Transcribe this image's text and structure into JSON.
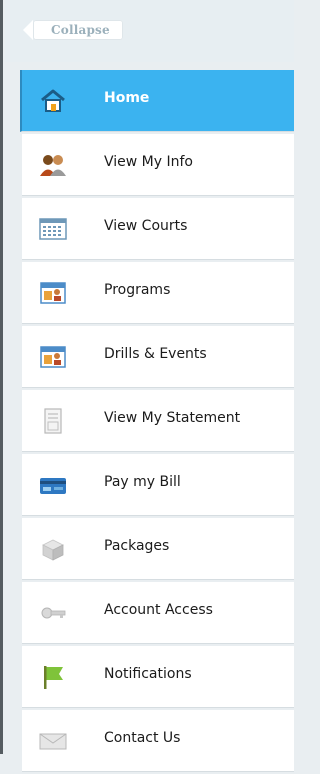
{
  "sidebar": {
    "collapse_label": "Collapse",
    "items": [
      {
        "label": "Home",
        "icon": "home-icon",
        "active": true
      },
      {
        "label": "View My Info",
        "icon": "users-icon"
      },
      {
        "label": "View Courts",
        "icon": "calendar-icon"
      },
      {
        "label": "Programs",
        "icon": "programs-icon"
      },
      {
        "label": "Drills & Events",
        "icon": "events-icon"
      },
      {
        "label": "View My Statement",
        "icon": "statement-icon"
      },
      {
        "label": "Pay my Bill",
        "icon": "credit-card-icon"
      },
      {
        "label": "Packages",
        "icon": "packages-icon"
      },
      {
        "label": "Account Access",
        "icon": "key-icon"
      },
      {
        "label": "Notifications",
        "icon": "flag-icon"
      },
      {
        "label": "Contact Us",
        "icon": "envelope-icon"
      }
    ]
  },
  "colors": {
    "active_bg": "#3bb3f0",
    "sidebar_bg": "#e9eef1"
  }
}
